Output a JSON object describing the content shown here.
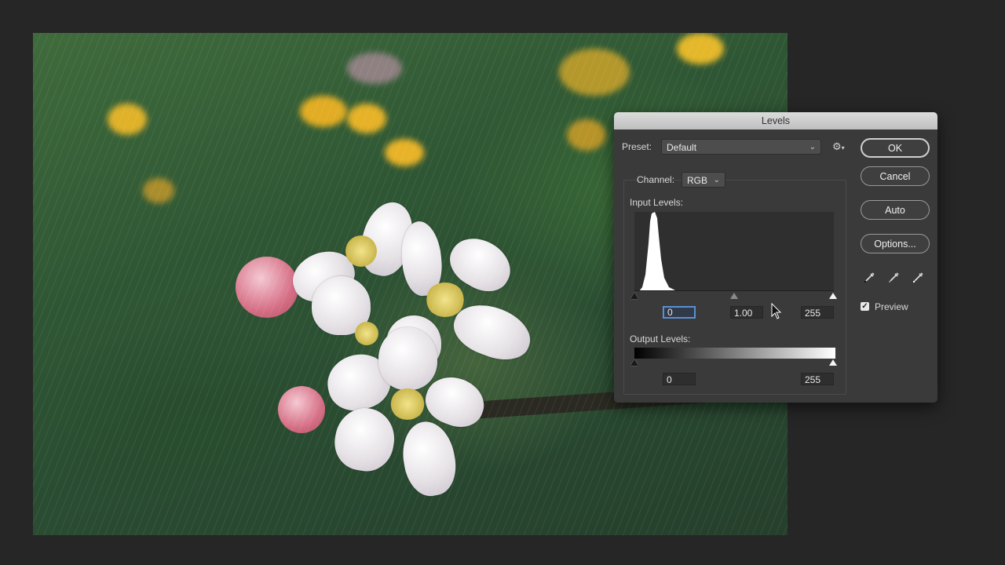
{
  "dialog": {
    "title": "Levels",
    "preset_label": "Preset:",
    "preset_value": "Default",
    "channel_label": "Channel:",
    "channel_value": "RGB",
    "input_levels_label": "Input Levels:",
    "input_black": "0",
    "input_gamma": "1.00",
    "input_white": "255",
    "output_levels_label": "Output Levels:",
    "output_black": "0",
    "output_white": "255",
    "buttons": {
      "ok": "OK",
      "cancel": "Cancel",
      "auto": "Auto",
      "options": "Options..."
    },
    "preview_label": "Preview",
    "preview_checked": true,
    "icons": {
      "preset_menu": "gear-icon",
      "eyedroppers": [
        "black-eyedropper-icon",
        "gray-eyedropper-icon",
        "white-eyedropper-icon"
      ]
    }
  }
}
